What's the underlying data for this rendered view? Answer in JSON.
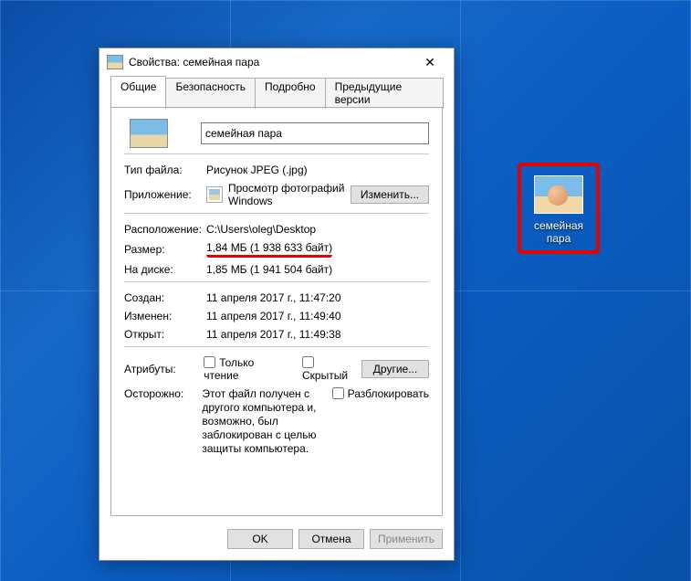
{
  "desktop": {
    "icon_label": "семейная пара"
  },
  "dialog": {
    "title": "Свойства: семейная пара",
    "tabs": {
      "general": "Общие",
      "security": "Безопасность",
      "details": "Подробно",
      "previous": "Предыдущие версии"
    },
    "filename": "семейная пара",
    "rows": {
      "filetype_label": "Тип файла:",
      "filetype_value": "Рисунок JPEG (.jpg)",
      "app_label": "Приложение:",
      "app_value": "Просмотр фотографий Windows",
      "change_btn": "Изменить...",
      "location_label": "Расположение:",
      "location_value": "C:\\Users\\oleg\\Desktop",
      "size_label": "Размер:",
      "size_value": "1,84 МБ (1 938 633 байт)",
      "ondisk_label": "На диске:",
      "ondisk_value": "1,85 МБ (1 941 504 байт)",
      "created_label": "Создан:",
      "created_value": "11 апреля 2017 г., 11:47:20",
      "modified_label": "Изменен:",
      "modified_value": "11 апреля 2017 г., 11:49:40",
      "opened_label": "Открыт:",
      "opened_value": "11 апреля 2017 г., 11:49:38",
      "attr_label": "Атрибуты:",
      "readonly": "Только чтение",
      "hidden": "Скрытый",
      "other_btn": "Другие...",
      "sec_label": "Осторожно:",
      "sec_text": "Этот файл получен с другого компьютера и, возможно, был заблокирован с целью защиты компьютера.",
      "unblock": "Разблокировать"
    },
    "footer": {
      "ok": "OK",
      "cancel": "Отмена",
      "apply": "Применить"
    }
  }
}
